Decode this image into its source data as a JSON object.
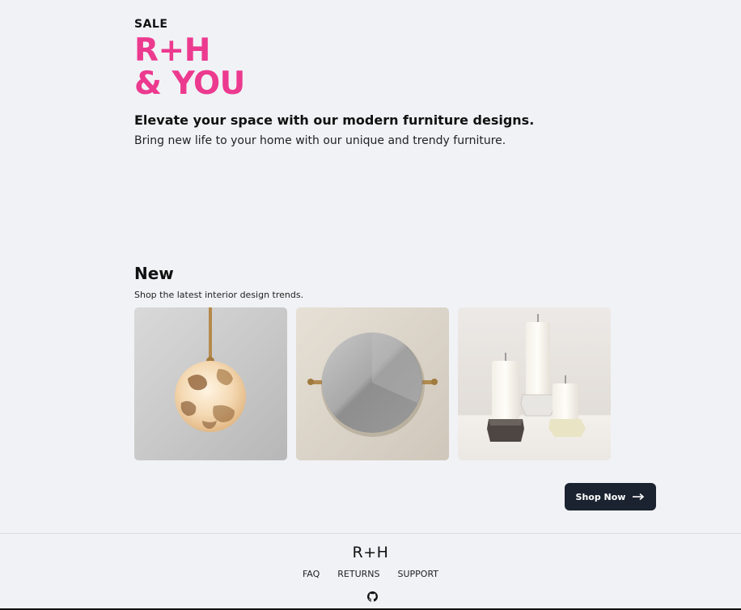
{
  "hero": {
    "sale_label": "SALE",
    "brand_line1": "R+H",
    "brand_line2": "& YOU",
    "headline": "Elevate your space with our modern furniture designs.",
    "subline": "Bring new life to your home with our unique and trendy furniture."
  },
  "new_section": {
    "title": "New",
    "subtitle": "Shop the latest interior design trends.",
    "products": [
      {
        "icon": "pendant-lamp-image"
      },
      {
        "icon": "round-mirror-image"
      },
      {
        "icon": "candles-image"
      }
    ],
    "shop_button": {
      "label": "Shop Now",
      "icon": "arrow-right-icon"
    }
  },
  "footer": {
    "logo": "R+H",
    "links": [
      "FAQ",
      "RETURNS",
      "SUPPORT"
    ],
    "social_icon": "github-icon"
  },
  "colors": {
    "background": "#f1f2f6",
    "accent_pink": "#ec3a8f",
    "button_dark": "#1b2230",
    "text": "#111111"
  }
}
